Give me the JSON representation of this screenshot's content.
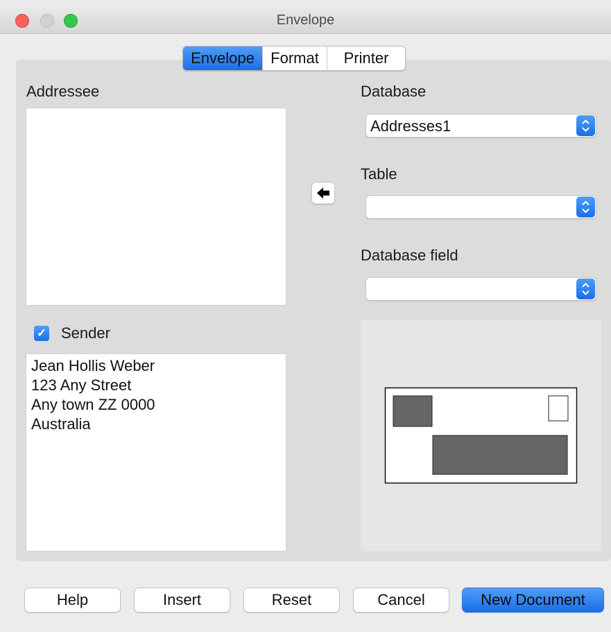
{
  "window": {
    "title": "Envelope"
  },
  "tabs": [
    {
      "label": "Envelope",
      "active": true
    },
    {
      "label": "Format",
      "active": false
    },
    {
      "label": "Printer",
      "active": false
    }
  ],
  "addressee": {
    "label": "Addressee",
    "value": ""
  },
  "database": {
    "label": "Database",
    "selected": "Addresses1"
  },
  "table": {
    "label": "Table",
    "selected": ""
  },
  "database_field": {
    "label": "Database field",
    "selected": ""
  },
  "sender": {
    "label": "Sender",
    "checked": true,
    "lines": [
      "Jean Hollis Weber",
      "123 Any Street",
      "Any town ZZ 0000",
      "Australia"
    ]
  },
  "buttons": {
    "help": "Help",
    "insert": "Insert",
    "reset": "Reset",
    "cancel": "Cancel",
    "new_document": "New Document"
  },
  "colors": {
    "accent": "#1a6fe8",
    "preview_block": "#666666"
  },
  "icons": {
    "insert_field": "left-arrow-icon",
    "checkbox": "checkmark-icon",
    "select": "up-down-chevron-icon"
  }
}
